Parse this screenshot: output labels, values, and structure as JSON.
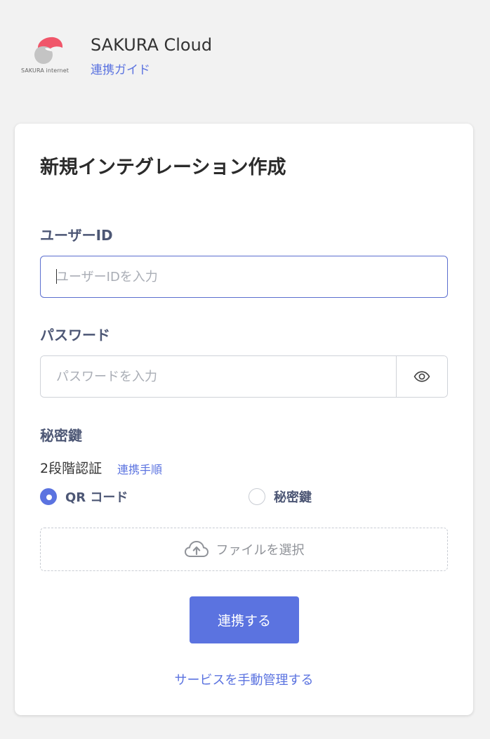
{
  "header": {
    "logo_text": "SAKURA internet",
    "app_title": "SAKURA Cloud",
    "guide_link": "連携ガイド"
  },
  "form": {
    "title": "新規インテグレーション作成",
    "user_id": {
      "label": "ユーザーID",
      "placeholder": "ユーザーIDを入力",
      "value": ""
    },
    "password": {
      "label": "パスワード",
      "placeholder": "パスワードを入力",
      "value": ""
    },
    "secret_key": {
      "label": "秘密鍵"
    },
    "two_factor": {
      "label": "2段階認証",
      "link": "連携手順",
      "options": [
        {
          "label": "QR コード",
          "selected": true
        },
        {
          "label": "秘密鍵",
          "selected": false
        }
      ]
    },
    "file_select": "ファイルを選択",
    "submit": "連携する",
    "manual_link": "サービスを手動管理する"
  },
  "colors": {
    "accent": "#5b73e0",
    "logo_red": "#f0566a",
    "logo_gray": "#c4c4c4",
    "label": "#4d5775",
    "background": "#f2f2f2"
  },
  "icons": {
    "logo": "sakura-logo-icon",
    "password_toggle": "eye-icon",
    "upload": "cloud-upload-icon"
  }
}
